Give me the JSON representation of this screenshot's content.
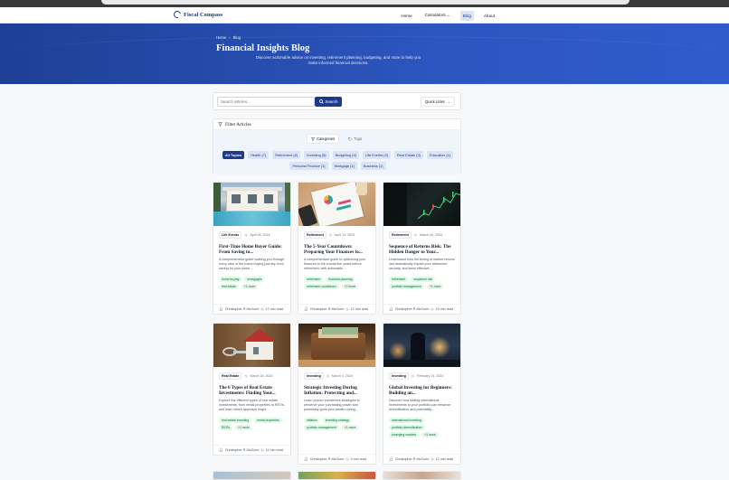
{
  "brand": {
    "name": "Fiscal Compass"
  },
  "nav": {
    "items": [
      {
        "label": "Home",
        "active": false
      },
      {
        "label": "Calculators ⌄",
        "active": false
      },
      {
        "label": "Blog",
        "active": true
      },
      {
        "label": "About",
        "active": false
      }
    ]
  },
  "hero": {
    "breadcrumb": [
      "Home",
      "›",
      "Blog"
    ],
    "title": "Financial Insights Blog",
    "subtitle": "Discover actionable advice on investing, retirement planning, budgeting, and more to help you make informed financial decisions."
  },
  "search": {
    "placeholder": "Search articles...",
    "button_label": "Search",
    "quick_links_label": "Quick Links"
  },
  "filters": {
    "title": "Filter Articles",
    "tabs": [
      {
        "label": "Categories",
        "active": true
      },
      {
        "label": "Tags",
        "active": false
      }
    ],
    "chips_row1": [
      "All Topics",
      "Health (7)",
      "Retirement (5)",
      "Investing (5)",
      "Budgeting (4)",
      "Life Events (3)",
      "Real Estate (3)",
      "Education (1)"
    ],
    "chips_row2": [
      "Personal Finance (1)",
      "Mortgage (1)",
      "Business (1)"
    ]
  },
  "articles": [
    {
      "category": "Life Events",
      "date": "April 28, 2024",
      "title": "First-Time Home Buyer Guide: From Saving to...",
      "excerpt": "A comprehensive guide walking you through every step of the home buying journey, from saving for your down...",
      "tags": [
        "home buying",
        "mortgages",
        "real estate",
        "+1 more"
      ],
      "author": "Christopher R McGuire",
      "read_time": "12 min read"
    },
    {
      "category": "Retirement",
      "date": "April 14, 2024",
      "title": "The 5-Year Countdown: Preparing Your Finances fo...",
      "excerpt": "A comprehensive guide to optimizing your finances in the crucial five years before retirement, with actionable...",
      "tags": [
        "retirement",
        "financial planning",
        "retirement countdown",
        "+2 more"
      ],
      "author": "Christopher R McGuire",
      "read_time": "12 min read"
    },
    {
      "category": "Retirement",
      "date": "March 18, 2024",
      "title": "Sequence of Returns Risk: The Hidden Danger to Your...",
      "excerpt": "Understand how the timing of market returns can dramatically impact your retirement security, and learn effective...",
      "tags": [
        "retirement",
        "sequence risk",
        "portfolio management",
        "+1 more"
      ],
      "author": "Christopher R McGuire",
      "read_time": "15 min read"
    },
    {
      "category": "Real Estate",
      "date": "March 18, 2024",
      "title": "The 6 Types of Real Estate Investments: Finding Your...",
      "excerpt": "Explore the different types of real estate investments, from rental properties to REITs, and learn which approach might...",
      "tags": [
        "real estate investing",
        "rental properties",
        "REITs",
        "+1 more"
      ],
      "author": "Christopher R McGuire",
      "read_time": "11 min read"
    },
    {
      "category": "Investing",
      "date": "March 4, 2024",
      "title": "Strategic Investing During Inflation: Protecting and...",
      "excerpt": "Learn proven investment strategies to preserve your purchasing power and potentially grow your wealth during...",
      "tags": [
        "inflation",
        "investing strategy",
        "portfolio management",
        "+1 more"
      ],
      "author": "Christopher R McGuire",
      "read_time": "9 min read"
    },
    {
      "category": "Investing",
      "date": "February 24, 2024",
      "title": "Global Investing for Beginners: Building an...",
      "excerpt": "Discover how adding international investments to your portfolio can enhance diversification and potentially...",
      "tags": [
        "international investing",
        "portfolio diversification",
        "emerging markets",
        "+1 more"
      ],
      "author": "Christopher R McGuire",
      "read_time": "12 min read"
    }
  ],
  "colors": {
    "brand": "#1e3a8a",
    "hero": "#2c56c0",
    "tag_bg": "#dcfce7",
    "tag_text": "#166534"
  }
}
